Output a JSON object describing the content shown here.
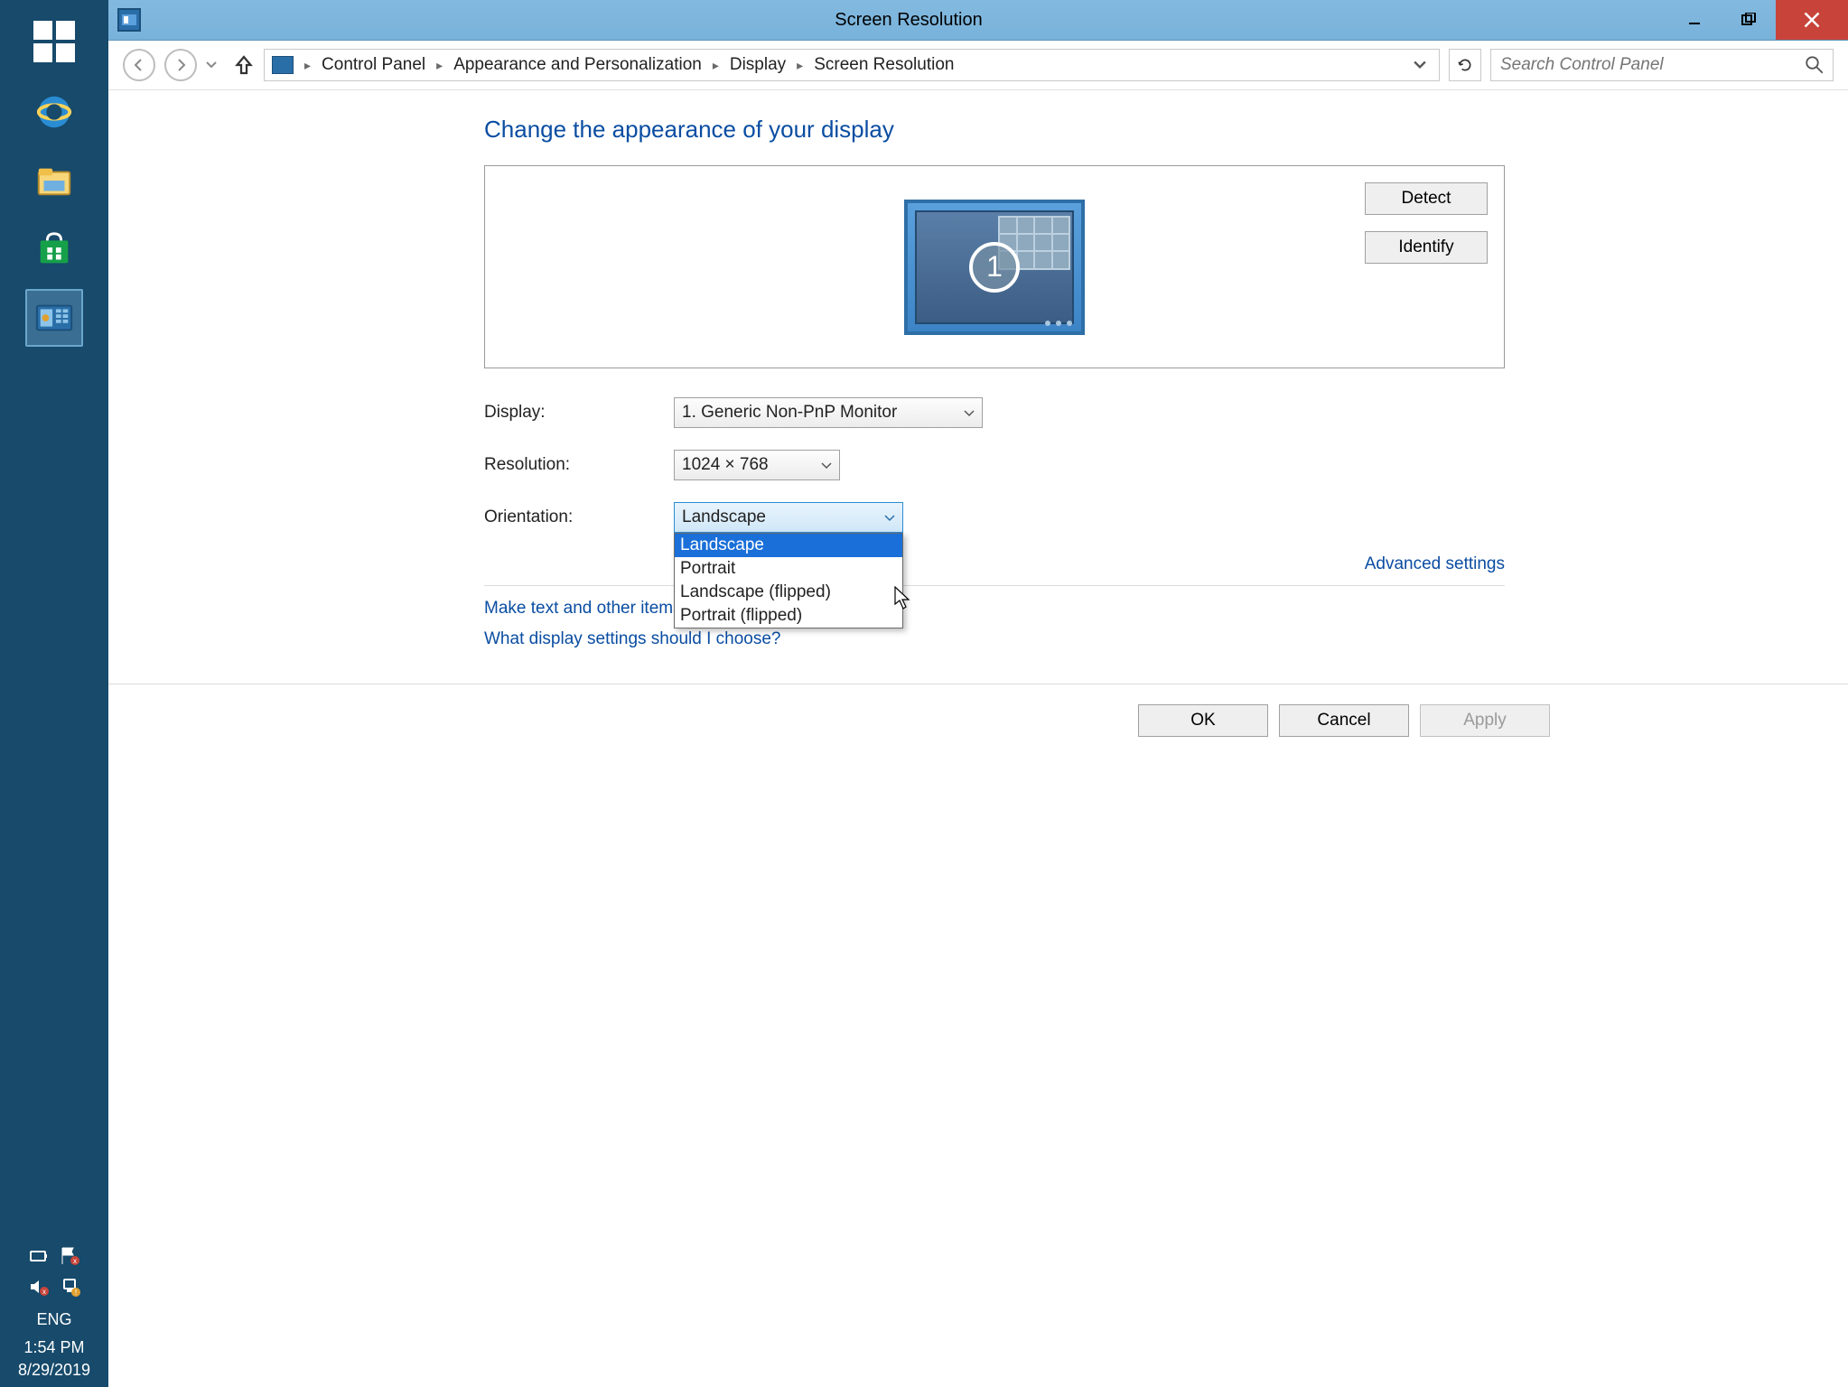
{
  "window": {
    "title": "Screen Resolution"
  },
  "breadcrumb": {
    "parts": [
      "Control Panel",
      "Appearance and Personalization",
      "Display",
      "Screen Resolution"
    ]
  },
  "search": {
    "placeholder": "Search Control Panel"
  },
  "page": {
    "heading": "Change the appearance of your display",
    "detect": "Detect",
    "identify": "Identify",
    "monitor_number": "1",
    "labels": {
      "display": "Display:",
      "resolution": "Resolution:",
      "orientation": "Orientation:"
    },
    "display_value": "1. Generic Non-PnP Monitor",
    "resolution_value": "1024 × 768",
    "orientation_value": "Landscape",
    "orientation_options": [
      "Landscape",
      "Portrait",
      "Landscape (flipped)",
      "Portrait (flipped)"
    ],
    "advanced": "Advanced settings",
    "link1": "Make text and other items larger or smaller",
    "link2": "What display settings should I choose?",
    "ok": "OK",
    "cancel": "Cancel",
    "apply": "Apply"
  },
  "taskbar": {
    "lang": "ENG",
    "time": "1:54 PM",
    "date": "8/29/2019"
  }
}
